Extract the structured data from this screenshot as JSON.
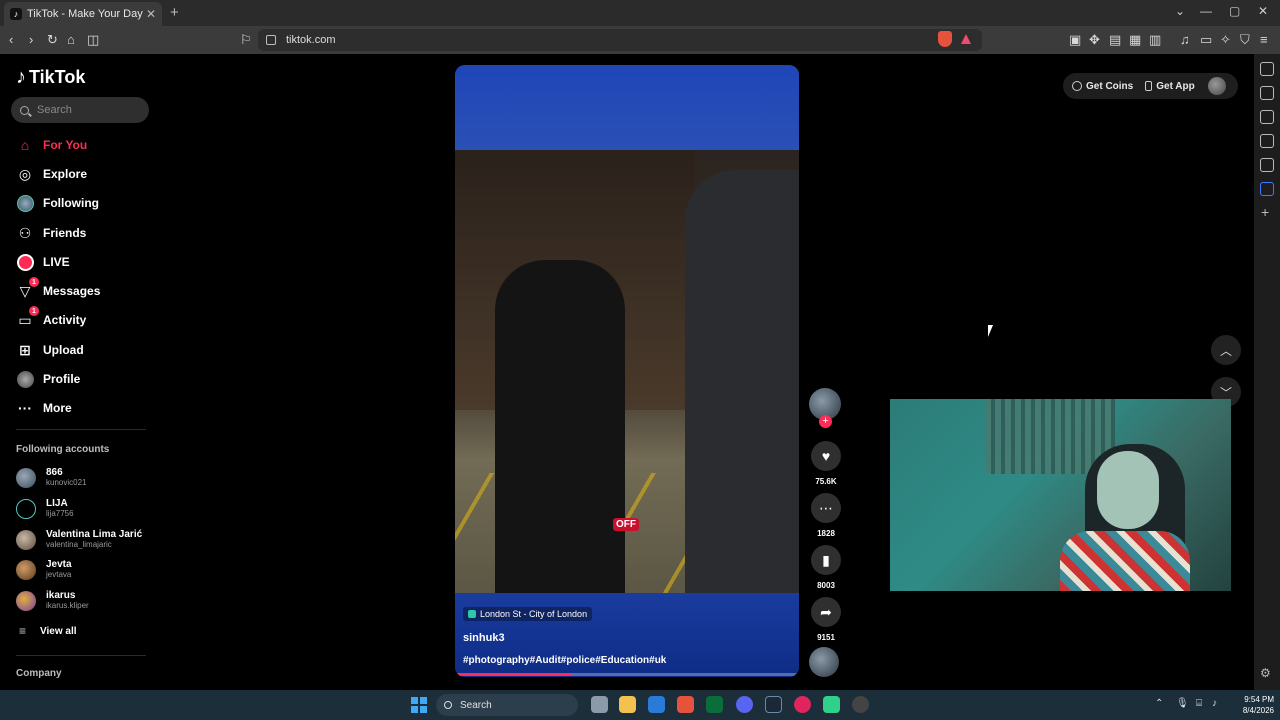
{
  "browser": {
    "tab_title": "TikTok - Make Your Day",
    "favicon": "♪",
    "url": "tiktok.com"
  },
  "tiktok": {
    "logo_text": "TikTok",
    "search_placeholder": "Search",
    "nav": [
      {
        "label": "For You",
        "icon": "home-icon",
        "active": true
      },
      {
        "label": "Explore",
        "icon": "compass-icon"
      },
      {
        "label": "Following",
        "icon": "avatar-icon"
      },
      {
        "label": "Friends",
        "icon": "friends-icon"
      },
      {
        "label": "LIVE",
        "icon": "live-icon"
      },
      {
        "label": "Messages",
        "icon": "messages-icon",
        "badge": "1"
      },
      {
        "label": "Activity",
        "icon": "activity-icon",
        "badge": "1"
      },
      {
        "label": "Upload",
        "icon": "upload-icon"
      },
      {
        "label": "Profile",
        "icon": "profile-icon"
      },
      {
        "label": "More",
        "icon": "more-icon"
      }
    ],
    "following_title": "Following accounts",
    "accounts": [
      {
        "name": "866",
        "handle": "kunovic021",
        "color": "#5a6b7c"
      },
      {
        "name": "LIJA",
        "handle": "lija7756",
        "color": "#0a2a2a"
      },
      {
        "name": "Valentina Lima Jarić",
        "handle": "valentina_limajaric",
        "color": "#8a7a6a"
      },
      {
        "name": "Jevta",
        "handle": "jevtava",
        "color": "#a06a3a"
      },
      {
        "name": "ikarus",
        "handle": "ikarus.kliper",
        "color": "#9a6ab0"
      }
    ],
    "view_all": "View all",
    "company": "Company",
    "top_buttons": {
      "coins": "Get Coins",
      "app": "Get App"
    }
  },
  "video": {
    "location": "London St - City of London",
    "off_label": "OFF",
    "author": "sinhuk3",
    "hashtags": "#photography#Audit#police#Education#uk",
    "progress": 0.34,
    "likes": "75.6K",
    "comments": "1828",
    "saves": "8003",
    "shares": "9151"
  },
  "taskbar": {
    "search_label": "Search",
    "time": "9:54 PM",
    "date": "8/4/2026"
  }
}
